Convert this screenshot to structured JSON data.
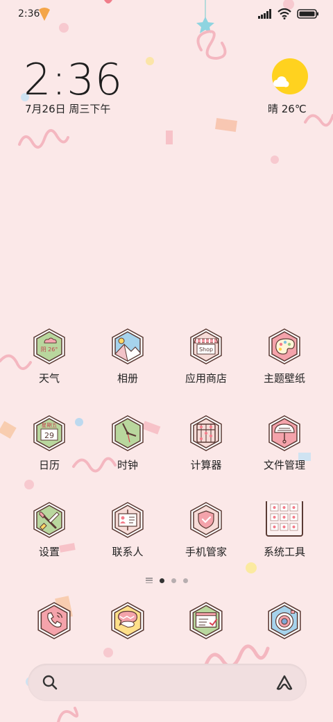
{
  "status_bar": {
    "time": "2:36"
  },
  "clock_widget": {
    "time": "2:36",
    "date": "7月26日 周三下午"
  },
  "weather_widget": {
    "text": "晴 26℃"
  },
  "apps": [
    {
      "label": "天气",
      "icon": "weather-icon",
      "glyph": "阴 26°"
    },
    {
      "label": "相册",
      "icon": "gallery-icon"
    },
    {
      "label": "应用商店",
      "icon": "app-store-icon",
      "glyph": "Shop"
    },
    {
      "label": "主题壁纸",
      "icon": "themes-icon"
    },
    {
      "label": "日历",
      "icon": "calendar-icon",
      "glyph_top": "星期五",
      "glyph": "29"
    },
    {
      "label": "时钟",
      "icon": "clock-icon"
    },
    {
      "label": "计算器",
      "icon": "calculator-icon"
    },
    {
      "label": "文件管理",
      "icon": "file-manager-icon"
    },
    {
      "label": "设置",
      "icon": "settings-icon"
    },
    {
      "label": "联系人",
      "icon": "contacts-icon"
    },
    {
      "label": "手机管家",
      "icon": "security-icon"
    },
    {
      "label": "系统工具",
      "icon": "system-tools-folder-icon"
    }
  ],
  "page_indicator": {
    "pages": 3,
    "current": 1
  },
  "dock": [
    {
      "icon": "phone-icon"
    },
    {
      "icon": "messages-icon"
    },
    {
      "icon": "browser-icon"
    },
    {
      "icon": "camera-icon"
    }
  ],
  "colors": {
    "background": "#fbe8e8",
    "icon_outline": "#5a3a34",
    "accent_pink": "#f2a5ad",
    "sun_yellow": "#ffd21f"
  }
}
